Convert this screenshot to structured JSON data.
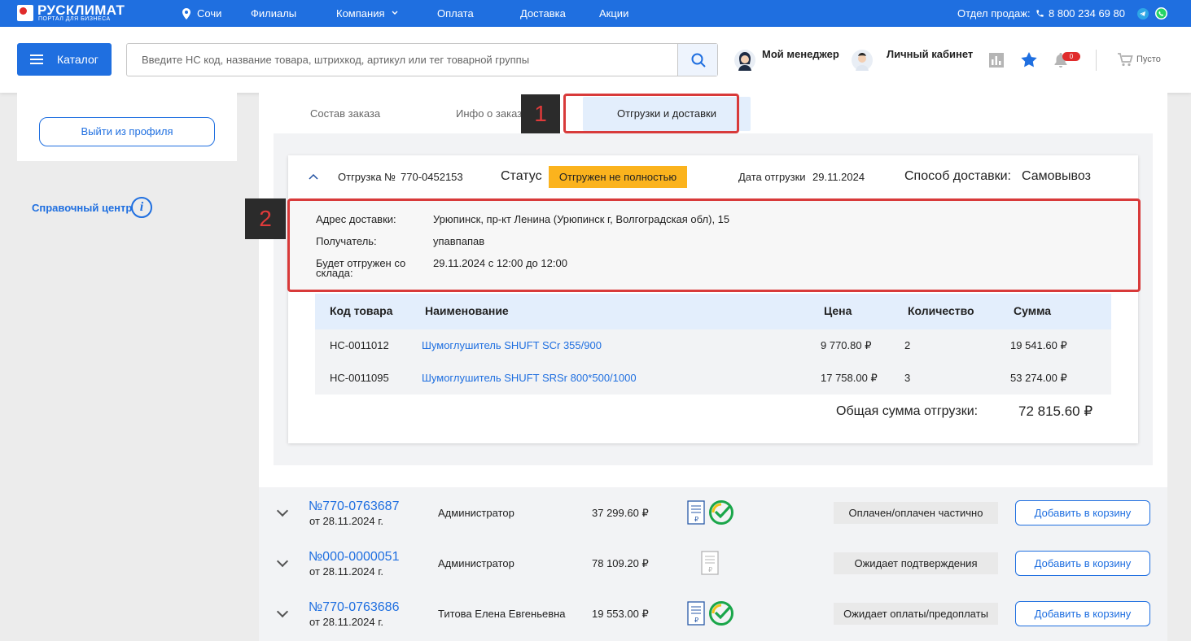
{
  "topbar": {
    "logo_title": "РУСКЛИМАТ",
    "logo_sub": "ПОРТАЛ ДЛЯ БИЗНЕСА",
    "city": "Сочи",
    "nav": [
      "Филиалы",
      "Компания",
      "Оплата",
      "Доставка",
      "Акции"
    ],
    "sales_label": "Отдел продаж:",
    "phone": "8 800 234 69 80"
  },
  "header": {
    "catalog": "Каталог",
    "search_placeholder": "Введите НС код, название товара, штрихкод, артикул или тег товарной группы",
    "manager": "Мой менеджер",
    "cabinet": "Личный кабинет",
    "notif_count": "0",
    "cart": "Пусто"
  },
  "sidebar": {
    "logout": "Выйти из профиля",
    "help": "Справочный центр",
    "help_icon_glyph": "i"
  },
  "tabs": {
    "items": [
      "Состав заказа",
      "Инфо о заказе",
      "Отгрузки и доставки"
    ],
    "active": 2
  },
  "shipment": {
    "label": "Отгрузка №",
    "number": "770-0452153",
    "status_label": "Статус",
    "status": "Отгружен не полностью",
    "date_label": "Дата отгрузки",
    "date": "29.11.2024",
    "method_label": "Способ доставки:",
    "method": "Самовывоз",
    "address_label": "Адрес доставки:",
    "address": "Урюпинск, пр-кт Ленина (Урюпинск г, Волгоградская обл), 15",
    "recipient_label": "Получатель:",
    "recipient": "упавпапав",
    "warehouse_label_1": "Будет отгружен со",
    "warehouse_label_2": "склада:",
    "warehouse_date": "29.11.2024 с 12:00 до 12:00",
    "columns": [
      "Код товара",
      "Наименование",
      "Цена",
      "Количество",
      "Сумма"
    ],
    "items": [
      {
        "code": "НС-0011012",
        "name": "Шумоглушитель SHUFT SCr 355/900",
        "price": "9 770.80 ₽",
        "qty": "2",
        "sum": "19 541.60 ₽"
      },
      {
        "code": "НС-0011095",
        "name": "Шумоглушитель SHUFT SRSr 800*500/1000",
        "price": "17 758.00 ₽",
        "qty": "3",
        "sum": "53 274.00 ₽"
      }
    ],
    "total_label": "Общая сумма отгрузки:",
    "total": "72 815.60 ₽"
  },
  "orders": [
    {
      "number": "№770-0763687",
      "date": "от 28.11.2024 г.",
      "author": "Администратор",
      "sum": "37 299.60 ₽",
      "status": "Оплачен/оплачен частично",
      "add": "Добавить в корзину",
      "paid_icon": true
    },
    {
      "number": "№000-0000051",
      "date": "от 28.11.2024 г.",
      "author": "Администратор",
      "sum": "78 109.20 ₽",
      "status": "Ожидает подтверждения",
      "add": "Добавить в корзину",
      "paid_icon": false
    },
    {
      "number": "№770-0763686",
      "date": "от 28.11.2024 г.",
      "author": "Титова Елена Евгеньевна",
      "sum": "19 553.00 ₽",
      "status": "Ожидает оплаты/предоплаты",
      "add": "Добавить в корзину",
      "paid_icon": true
    }
  ],
  "markers": [
    "1",
    "2"
  ],
  "colors": {
    "accent": "#1f6fe0",
    "status_badge": "#fbb31d",
    "highlight": "#d83a3a"
  }
}
